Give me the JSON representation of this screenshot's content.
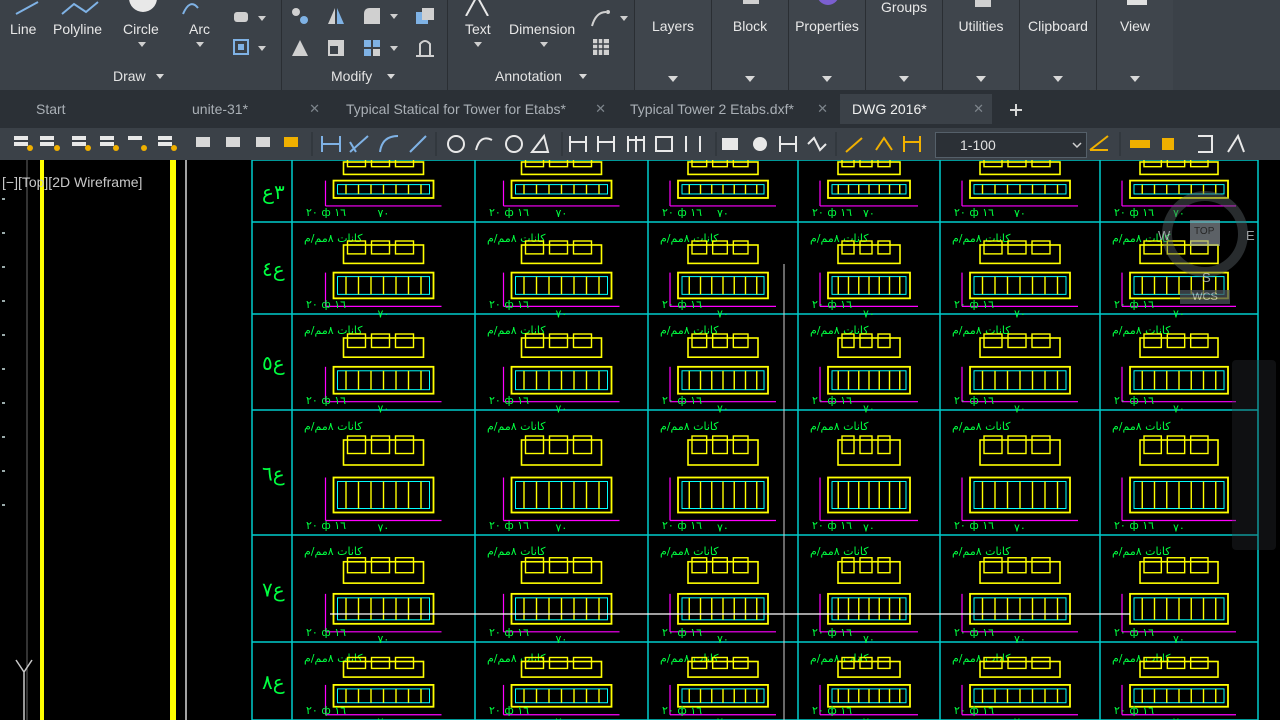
{
  "ribbon": {
    "draw_tools": {
      "line": "Line",
      "polyline": "Polyline",
      "circle": "Circle",
      "arc": "Arc"
    },
    "annotation_tools": {
      "text": "Text",
      "dimension": "Dimension"
    },
    "panels": {
      "draw": "Draw",
      "modify": "Modify",
      "annotation": "Annotation"
    },
    "right_panels": [
      "Layers",
      "Block",
      "Properties",
      "Groups",
      "Utilities",
      "Clipboard",
      "View"
    ]
  },
  "tabs": [
    {
      "label": "Start",
      "closable": false
    },
    {
      "label": "unite-31*",
      "closable": true
    },
    {
      "label": "Typical Statical for Tower for Etabs*",
      "closable": true
    },
    {
      "label": "Typical Tower 2 Etabs.dxf*",
      "closable": true
    },
    {
      "label": "DWG 2016*",
      "closable": true,
      "active": true
    }
  ],
  "new_tab_icon": "plus-icon",
  "toolbar": {
    "scale_value": "1-100"
  },
  "viewport": {
    "label": "[−][Top][2D Wireframe]"
  },
  "viewcube": {
    "top": "TOP",
    "west": "W",
    "east": "E",
    "south": "S",
    "wcs": "WCS"
  },
  "drawing": {
    "row_labels": [
      "٣ع",
      "ع٤",
      "ع٥",
      "ع٦",
      "ع٧",
      "ع٨"
    ],
    "note_text": "كانات ٨مم/م",
    "bar_text": "٢٠ ф ١٦",
    "width_text": "٧٠",
    "colors": {
      "grid": "#00cccc",
      "column": "#ffff00",
      "dim": "#ff00ff",
      "text": "#00ff40",
      "axis": "#ffff00"
    }
  }
}
